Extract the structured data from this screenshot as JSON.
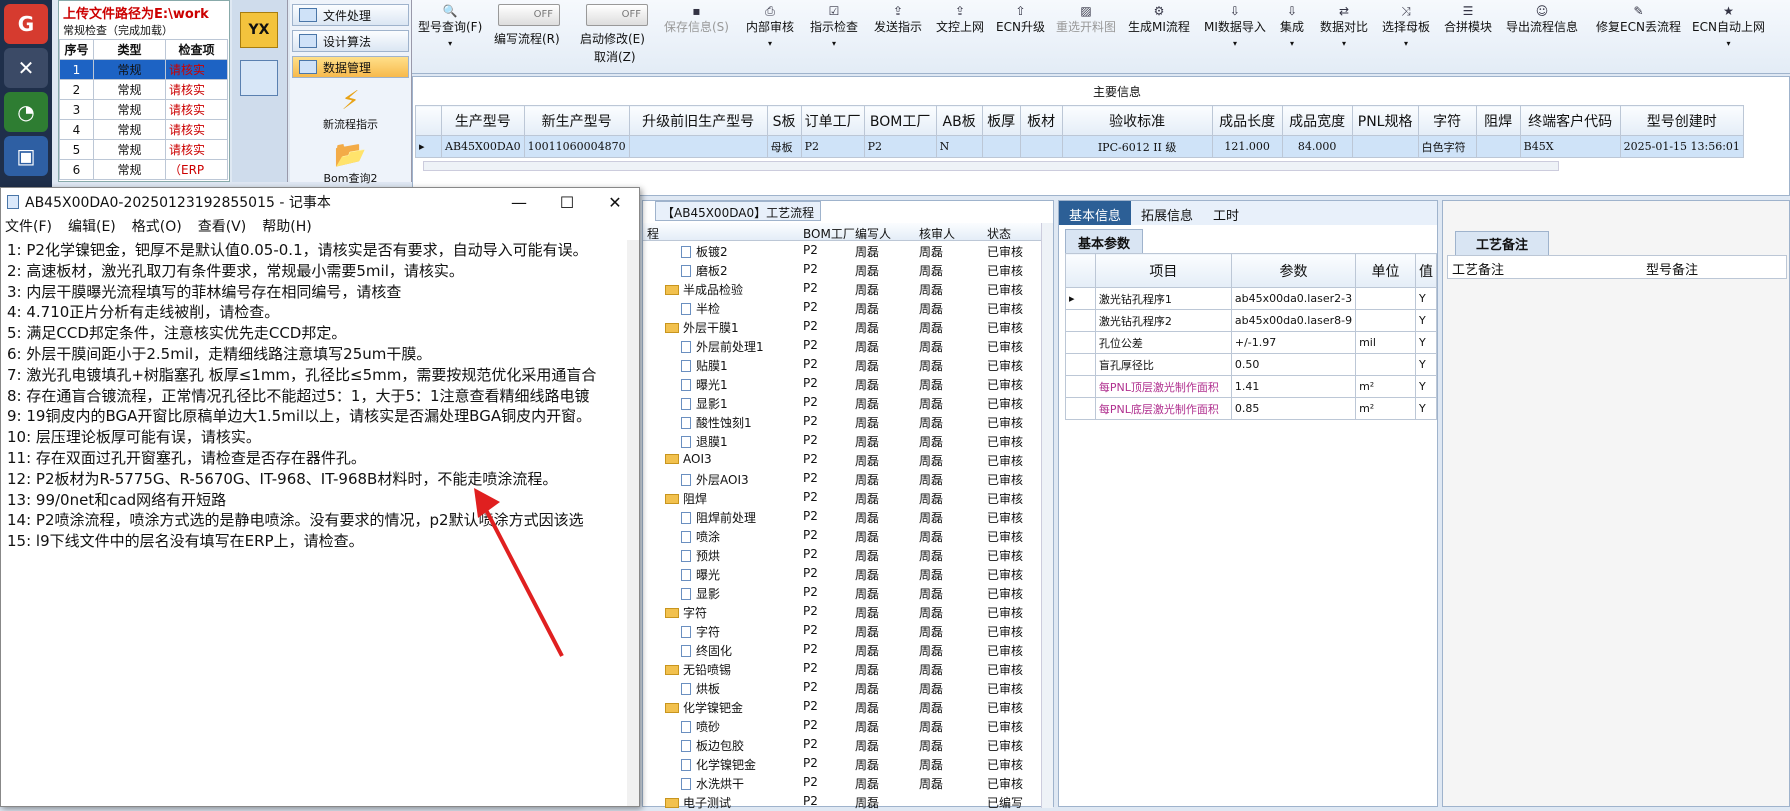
{
  "upload": {
    "title": "上传文件路径为E:\\work",
    "caption": "常规检查（完成加载）",
    "headers": [
      "序号",
      "类型",
      "检查项"
    ],
    "rows": [
      {
        "no": "1",
        "type": "常规",
        "item": "请核实"
      },
      {
        "no": "2",
        "type": "常规",
        "item": "请核实"
      },
      {
        "no": "3",
        "type": "常规",
        "item": "请核实"
      },
      {
        "no": "4",
        "type": "常规",
        "item": "请核实"
      },
      {
        "no": "5",
        "type": "常规",
        "item": "请核实"
      },
      {
        "no": "6",
        "type": "常规",
        "item": "（ERP"
      }
    ]
  },
  "app_logo": "YX",
  "nav": {
    "items": [
      "文件处理",
      "设计算法",
      "数据管理"
    ],
    "new_flow": "新流程指示",
    "bom_query": "Bom查询2"
  },
  "toolbar": {
    "model_query": "型号查询(F)",
    "edit_flow_toggle": "OFF",
    "edit_flow": "编写流程(R)",
    "start_modify_toggle": "OFF",
    "start_modify": "启动修改(E)",
    "cancel": "取消(Z)",
    "save_info": "保存信息(S)",
    "internal_review": "内部审核",
    "guide_check": "指示检查",
    "send_guide": "发送指示",
    "doc_upload": "文控上网",
    "ecn_upgrade": "ECN升级",
    "redraw_panel": "重选开料图",
    "gen_mi_flow": "生成MI流程",
    "mi_import": "MI数据导入",
    "integrate": "集成",
    "data_compare": "数据对比",
    "select_master": "选择母板",
    "merge_module": "合拼模块",
    "export_flow": "导出流程信息",
    "fix_ecn": "修复ECN丢流程",
    "ecn_auto_upload": "ECN自动上网"
  },
  "main_info": {
    "caption": "主要信息",
    "headers": [
      "生产型号",
      "新生产型号",
      "升级前旧生产型号",
      "S板",
      "订单工厂",
      "BOM工厂",
      "AB板",
      "板厚",
      "板材",
      "验收标准",
      "成品长度",
      "成品宽度",
      "PNL规格",
      "字符",
      "阻焊",
      "终端客户代码",
      "型号创建时"
    ],
    "row": [
      "AB45X00DA0",
      "10011060004870",
      "",
      "母板",
      "P2",
      "P2",
      "N",
      "",
      "",
      "IPC-6012 II 级",
      "121.000",
      "84.000",
      "",
      "白色字符",
      "",
      "B45X",
      "2025-01-15 13:56:01"
    ]
  },
  "notepad": {
    "title": "AB45X00DA0-20250123192855015 - 记事本",
    "menus": [
      "文件(F)",
      "编辑(E)",
      "格式(O)",
      "查看(V)",
      "帮助(H)"
    ],
    "lines": [
      "1:   P2化学镍钯金，钯厚不是默认值0.05-0.1，请核实是否有要求，自动导入可能有误。",
      "2:   高速板材，激光孔取刀有条件要求，常规最小需要5mil，请核实。",
      "3:   内层干膜曝光流程填写的菲林编号存在相同编号，请核查",
      "4: 4.710正片分析有走线被削，请检查。",
      "5: 满足CCD邦定条件，注意核实优先走CCD邦定。",
      "6: 外层干膜间距小于2.5mil，走精细线路注意填写25um干膜。",
      "7:   激光孔电镀填孔+树脂塞孔 板厚≤1mm，孔径比≤5mm，需要按规范优化采用通盲合",
      "8:   存在通盲合镀流程，正常情况孔径比不能超过5：1，大于5：1注意查看精细线路电镀",
      "9: 19铜皮内的BGA开窗比原稿单边大1.5mil以上，请核实是否漏处理BGA铜皮内开窗。",
      "10: 层压理论板厚可能有误，请核实。",
      "11: 存在双面过孔开窗塞孔，请检查是否存在器件孔。",
      "12:   P2板材为R-5775G、R-5670G、IT-968、IT-968B材料时，不能走喷涂流程。",
      "13: 99/0net和cad网络有开短路",
      "14:   P2喷涂流程，喷涂方式选的是静电喷涂。没有要求的情况，p2默认喷涂方式因该选",
      "15: l9下线文件中的层名没有填写在ERP上，请检查。"
    ]
  },
  "process_tree": {
    "tab": "【AB45X00DA0】工艺流程",
    "headers": [
      "程",
      "BOM工厂",
      "编写人",
      "核审人",
      "状态"
    ],
    "rows": [
      {
        "name": "板镀2",
        "kind": "file",
        "factory": "P2",
        "writer": "周磊",
        "reviewer": "周磊",
        "status": "已审核"
      },
      {
        "name": "磨板2",
        "kind": "file",
        "factory": "P2",
        "writer": "周磊",
        "reviewer": "周磊",
        "status": "已审核"
      },
      {
        "name": "半成品检验",
        "kind": "folder",
        "factory": "P2",
        "writer": "周磊",
        "reviewer": "周磊",
        "status": "已审核"
      },
      {
        "name": "半检",
        "kind": "file",
        "factory": "P2",
        "writer": "周磊",
        "reviewer": "周磊",
        "status": "已审核"
      },
      {
        "name": "外层干膜1",
        "kind": "folder",
        "factory": "P2",
        "writer": "周磊",
        "reviewer": "周磊",
        "status": "已审核"
      },
      {
        "name": "外层前处理1",
        "kind": "file",
        "factory": "P2",
        "writer": "周磊",
        "reviewer": "周磊",
        "status": "已审核"
      },
      {
        "name": "贴膜1",
        "kind": "file",
        "factory": "P2",
        "writer": "周磊",
        "reviewer": "周磊",
        "status": "已审核"
      },
      {
        "name": "曝光1",
        "kind": "file",
        "factory": "P2",
        "writer": "周磊",
        "reviewer": "周磊",
        "status": "已审核"
      },
      {
        "name": "显影1",
        "kind": "file",
        "factory": "P2",
        "writer": "周磊",
        "reviewer": "周磊",
        "status": "已审核"
      },
      {
        "name": "酸性蚀刻1",
        "kind": "file",
        "factory": "P2",
        "writer": "周磊",
        "reviewer": "周磊",
        "status": "已审核"
      },
      {
        "name": "退膜1",
        "kind": "file",
        "factory": "P2",
        "writer": "周磊",
        "reviewer": "周磊",
        "status": "已审核"
      },
      {
        "name": "AOI3",
        "kind": "folder",
        "factory": "P2",
        "writer": "周磊",
        "reviewer": "周磊",
        "status": "已审核"
      },
      {
        "name": "外层AOI3",
        "kind": "file",
        "factory": "P2",
        "writer": "周磊",
        "reviewer": "周磊",
        "status": "已审核"
      },
      {
        "name": "阻焊",
        "kind": "folder",
        "factory": "P2",
        "writer": "周磊",
        "reviewer": "周磊",
        "status": "已审核"
      },
      {
        "name": "阻焊前处理",
        "kind": "file",
        "factory": "P2",
        "writer": "周磊",
        "reviewer": "周磊",
        "status": "已审核"
      },
      {
        "name": "喷涂",
        "kind": "file",
        "factory": "P2",
        "writer": "周磊",
        "reviewer": "周磊",
        "status": "已审核"
      },
      {
        "name": "预烘",
        "kind": "file",
        "factory": "P2",
        "writer": "周磊",
        "reviewer": "周磊",
        "status": "已审核"
      },
      {
        "name": "曝光",
        "kind": "file",
        "factory": "P2",
        "writer": "周磊",
        "reviewer": "周磊",
        "status": "已审核"
      },
      {
        "name": "显影",
        "kind": "file",
        "factory": "P2",
        "writer": "周磊",
        "reviewer": "周磊",
        "status": "已审核"
      },
      {
        "name": "字符",
        "kind": "folder",
        "factory": "P2",
        "writer": "周磊",
        "reviewer": "周磊",
        "status": "已审核"
      },
      {
        "name": "字符",
        "kind": "file",
        "factory": "P2",
        "writer": "周磊",
        "reviewer": "周磊",
        "status": "已审核"
      },
      {
        "name": "终固化",
        "kind": "file",
        "factory": "P2",
        "writer": "周磊",
        "reviewer": "周磊",
        "status": "已审核"
      },
      {
        "name": "无铅喷锡",
        "kind": "folder",
        "factory": "P2",
        "writer": "周磊",
        "reviewer": "周磊",
        "status": "已审核"
      },
      {
        "name": "烘板",
        "kind": "file",
        "factory": "P2",
        "writer": "周磊",
        "reviewer": "周磊",
        "status": "已审核"
      },
      {
        "name": "化学镍钯金",
        "kind": "folder",
        "factory": "P2",
        "writer": "周磊",
        "reviewer": "周磊",
        "status": "已审核"
      },
      {
        "name": "喷砂",
        "kind": "file",
        "factory": "P2",
        "writer": "周磊",
        "reviewer": "周磊",
        "status": "已审核"
      },
      {
        "name": "板边包胶",
        "kind": "file",
        "factory": "P2",
        "writer": "周磊",
        "reviewer": "周磊",
        "status": "已审核"
      },
      {
        "name": "化学镍钯金",
        "kind": "file",
        "factory": "P2",
        "writer": "周磊",
        "reviewer": "周磊",
        "status": "已审核"
      },
      {
        "name": "水洗烘干",
        "kind": "file",
        "factory": "P2",
        "writer": "周磊",
        "reviewer": "周磊",
        "status": "已审核"
      },
      {
        "name": "电子测试",
        "kind": "folder",
        "factory": "P2",
        "writer": "周磊",
        "reviewer": "",
        "status": "已编写"
      }
    ]
  },
  "info_panel": {
    "tabs": [
      "基本信息",
      "拓展信息",
      "工时"
    ],
    "basic_caption": "基本参数",
    "headers": [
      "项目",
      "参数",
      "单位",
      "值"
    ],
    "rows": [
      {
        "item": "激光钻孔程序1",
        "param": "ab45x00da0.laser2-3",
        "unit": "",
        "flag": "Y",
        "pink": false
      },
      {
        "item": "激光钻孔程序2",
        "param": "ab45x00da0.laser8-9",
        "unit": "",
        "flag": "Y",
        "pink": false
      },
      {
        "item": "孔位公差",
        "param": "+/-1.97",
        "unit": "mil",
        "flag": "Y",
        "pink": false
      },
      {
        "item": "盲孔厚径比",
        "param": "0.50",
        "unit": "",
        "flag": "Y",
        "pink": false
      },
      {
        "item": "每PNL顶层激光制作面积",
        "param": "1.41",
        "unit": "m²",
        "flag": "Y",
        "pink": true
      },
      {
        "item": "每PNL底层激光制作面积",
        "param": "0.85",
        "unit": "m²",
        "flag": "Y",
        "pink": true
      }
    ]
  },
  "notes_panel": {
    "caption": "工艺备注",
    "headers": [
      "工艺备注",
      "型号备注"
    ]
  },
  "colors": {
    "sidebar": "#1f2f4a",
    "warn_text": "#cc0000",
    "arrow": "#e02020",
    "active_tab": "#2c5f96"
  }
}
